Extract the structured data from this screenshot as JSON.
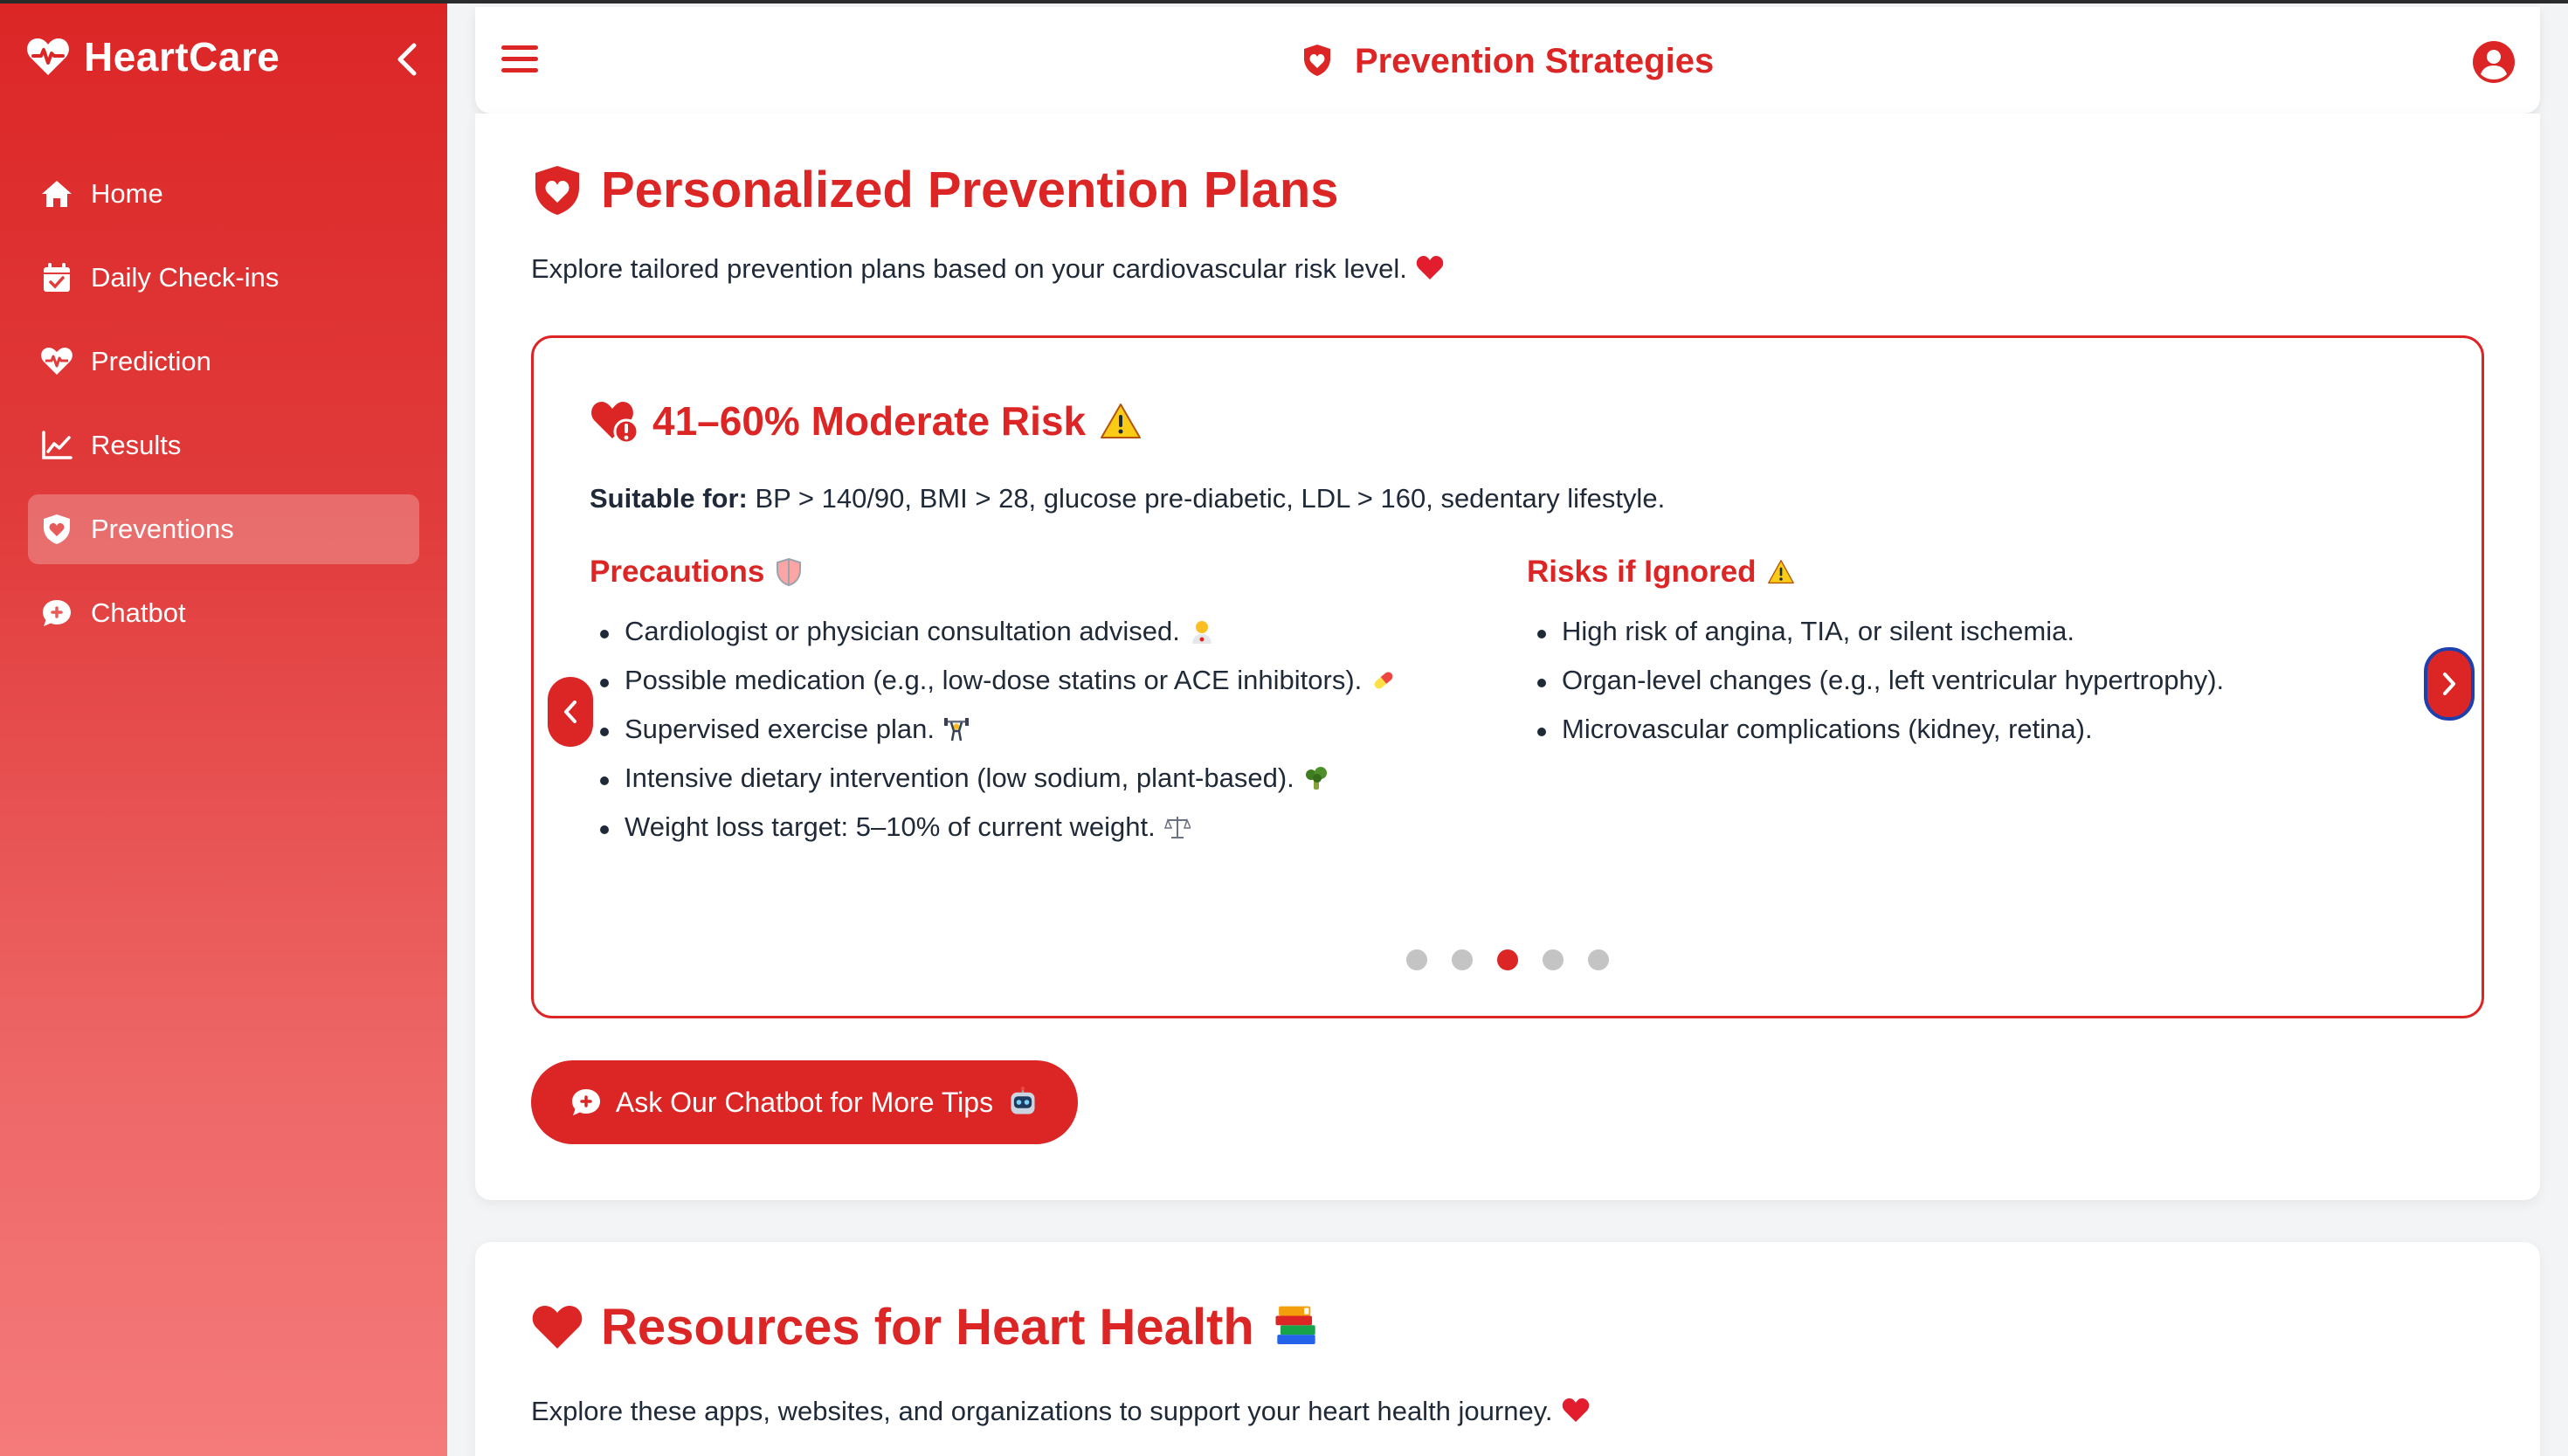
{
  "sidebar": {
    "brand": "HeartCare",
    "items": [
      {
        "label": "Home",
        "icon": "home-icon"
      },
      {
        "label": "Daily Check-ins",
        "icon": "calendar-check-icon"
      },
      {
        "label": "Prediction",
        "icon": "heart-pulse-icon"
      },
      {
        "label": "Results",
        "icon": "chart-line-icon"
      },
      {
        "label": "Preventions",
        "icon": "shield-heart-icon",
        "active": true
      },
      {
        "label": "Chatbot",
        "icon": "chat-icon"
      }
    ]
  },
  "header": {
    "title": "Prevention Strategies",
    "icons": [
      "menu-icon",
      "shield-heart-icon",
      "user-circle-icon"
    ]
  },
  "main": {
    "title": "Personalized Prevention Plans",
    "subtitle": "Explore tailored prevention plans based on your cardiovascular risk level.",
    "carousel": {
      "slide_title": "41–60% Moderate Risk",
      "suitable_label": "Suitable for:",
      "suitable_text": "BP > 140/90, BMI > 28, glucose pre-diabetic, LDL > 160, sedentary lifestyle.",
      "precautions_title": "Precautions",
      "precautions": [
        "Cardiologist or physician consultation advised.",
        "Possible medication (e.g., low-dose statins or ACE inhibitors).",
        "Supervised exercise plan.",
        "Intensive dietary intervention (low sodium, plant-based).",
        "Weight loss target: 5–10% of current weight."
      ],
      "risks_title": "Risks if Ignored",
      "risks": [
        "High risk of angina, TIA, or silent ischemia.",
        "Organ-level changes (e.g., left ventricular hypertrophy).",
        "Microvascular complications (kidney, retina)."
      ],
      "total_slides": 5,
      "active_slide": 3
    },
    "cta_label": "Ask Our Chatbot for More Tips"
  },
  "resources": {
    "title": "Resources for Heart Health",
    "subtitle": "Explore these apps, websites, and organizations to support your heart health journey."
  },
  "colors": {
    "accent": "#dc2626",
    "focus_ring": "#1e40af",
    "dot_inactive": "#c4c4c4"
  }
}
